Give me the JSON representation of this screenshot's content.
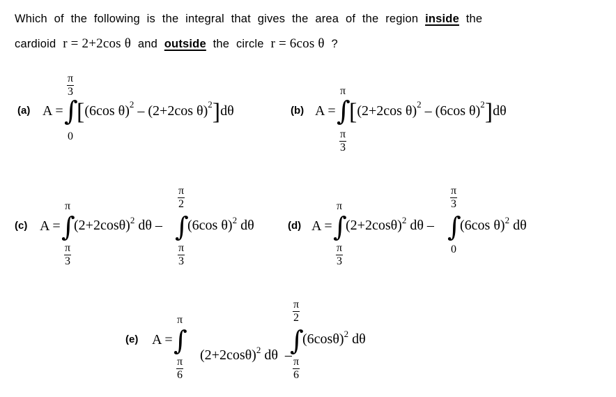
{
  "question": {
    "line1_prefix": "Which of the following is the integral that gives the area of the region",
    "line1_emph": "inside",
    "line1_suffix": "the",
    "line2_prefix": "cardioid",
    "cardioid_eq": "r = 2+2cos θ",
    "line2_mid": "and",
    "line2_emph": "outside",
    "line2_mid2": "the circle",
    "circle_eq": "r = 6cos θ",
    "qmark": "?"
  },
  "options": {
    "a": {
      "label": "(a)",
      "lhs": "A =",
      "upper_num": "π",
      "upper_den": "3",
      "lower": "0",
      "integrand_open": "[",
      "term1": "(6cos θ)",
      "exp1": "2",
      "minus": " – ",
      "term2": "(2+2cos θ)",
      "exp2": "2",
      "integrand_close": "]",
      "dtheta": "dθ"
    },
    "b": {
      "label": "(b)",
      "lhs": "A =",
      "upper": "π",
      "lower_num": "π",
      "lower_den": "3",
      "integrand_open": "[",
      "term1": "(2+2cos θ)",
      "exp1": "2",
      "minus": " – ",
      "term2": "(6cos θ)",
      "exp2": "2",
      "integrand_close": "]",
      "dtheta": "dθ"
    },
    "c": {
      "label": "(c)",
      "lhs": "A =",
      "int1_upper": "π",
      "int1_lower_num": "π",
      "int1_lower_den": "3",
      "int1_body": "(2+2cosθ)",
      "int1_exp": "2",
      "int1_d": " dθ – ",
      "int2_upper_num": "π",
      "int2_upper_den": "2",
      "int2_lower_num": "π",
      "int2_lower_den": "3",
      "int2_body": "(6cos θ)",
      "int2_exp": "2",
      "int2_d": " dθ"
    },
    "d": {
      "label": "(d)",
      "lhs": "A =",
      "int1_upper": "π",
      "int1_lower_num": "π",
      "int1_lower_den": "3",
      "int1_body": "(2+2cosθ)",
      "int1_exp": "2",
      "int1_d": " dθ – ",
      "int2_upper_num": "π",
      "int2_upper_den": "3",
      "int2_lower": "0",
      "int2_body": "(6cos θ)",
      "int2_exp": "2",
      "int2_d": " dθ"
    },
    "e": {
      "label": "(e)",
      "lhs": "A =",
      "int1_upper": "π",
      "int1_lower_num": "π",
      "int1_lower_den": "6",
      "int1_body": "(2+2cosθ)",
      "int1_exp": "2",
      "int1_d": " dθ  – ",
      "int2_upper_num": "π",
      "int2_upper_den": "2",
      "int2_lower_num": "π",
      "int2_lower_den": "6",
      "int2_body": "(6cosθ)",
      "int2_exp": "2",
      "int2_d": " dθ"
    }
  }
}
